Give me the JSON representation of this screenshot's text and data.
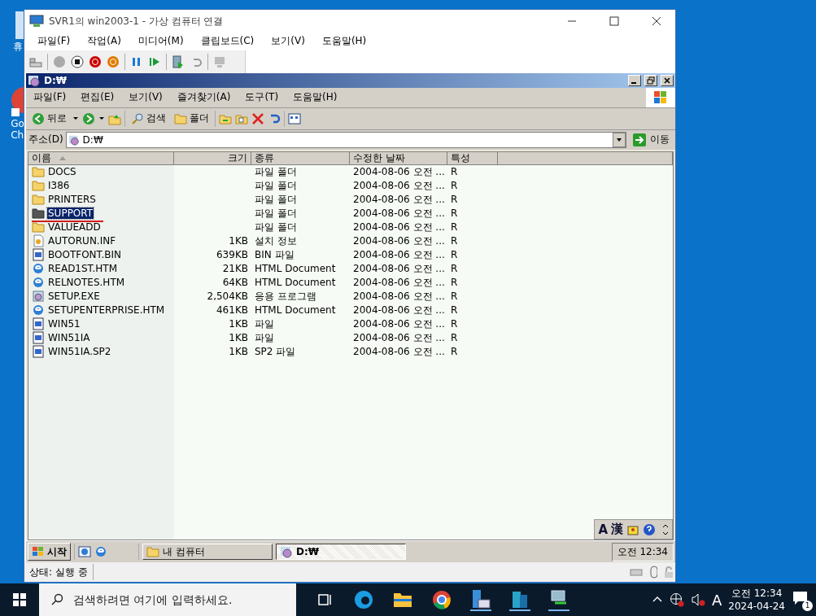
{
  "desktop_icons": [
    {
      "lines": [
        "휴"
      ]
    },
    {
      "lines": [
        "Go",
        "Ch"
      ]
    }
  ],
  "vm_window": {
    "title": "SVR1의 win2003-1 - 가상 컴퓨터 연결",
    "menu": [
      "파일(F)",
      "작업(A)",
      "미디어(M)",
      "클립보드(C)",
      "보기(V)",
      "도움말(H)"
    ],
    "status": "상태: 실행 중"
  },
  "explorer": {
    "title": "D:₩",
    "menu": [
      "파일(F)",
      "편집(E)",
      "보기(V)",
      "즐겨찾기(A)",
      "도구(T)",
      "도움말(H)"
    ],
    "toolbar": {
      "back": "뒤로",
      "search": "검색",
      "folders": "폴더"
    },
    "address": {
      "label": "주소(D)",
      "value": "D:₩",
      "go": "이동"
    },
    "columns": [
      {
        "label": "이름",
        "sorted": true
      },
      {
        "label": "크기",
        "sorted": false
      },
      {
        "label": "종류",
        "sorted": false
      },
      {
        "label": "수정한 날짜",
        "sorted": false
      },
      {
        "label": "특성",
        "sorted": false
      }
    ],
    "files": [
      {
        "name": "DOCS",
        "type": "파일 폴더",
        "date": "2004-08-06 오전 ...",
        "attr": "R",
        "kind": "folder",
        "selected": false
      },
      {
        "name": "I386",
        "type": "파일 폴더",
        "date": "2004-08-06 오전 ...",
        "attr": "R",
        "kind": "folder",
        "selected": false
      },
      {
        "name": "PRINTERS",
        "type": "파일 폴더",
        "date": "2004-08-06 오전 ...",
        "attr": "R",
        "kind": "folder",
        "selected": false
      },
      {
        "name": "SUPPORT",
        "type": "파일 폴더",
        "date": "2004-08-06 오전 ...",
        "attr": "R",
        "kind": "folder",
        "selected": true
      },
      {
        "name": "VALUEADD",
        "type": "파일 폴더",
        "date": "2004-08-06 오전 ...",
        "attr": "R",
        "kind": "folder",
        "selected": false
      },
      {
        "name": "AUTORUN.INF",
        "size": "1KB",
        "type": "설치 정보",
        "date": "2004-08-06 오전 ...",
        "attr": "R",
        "kind": "setup-info",
        "selected": false
      },
      {
        "name": "BOOTFONT.BIN",
        "size": "639KB",
        "type": "BIN 파일",
        "date": "2004-08-06 오전 ...",
        "attr": "R",
        "kind": "file",
        "selected": false
      },
      {
        "name": "READ1ST.HTM",
        "size": "21KB",
        "type": "HTML Document",
        "date": "2004-08-06 오전 ...",
        "attr": "R",
        "kind": "html",
        "selected": false
      },
      {
        "name": "RELNOTES.HTM",
        "size": "64KB",
        "type": "HTML Document",
        "date": "2004-08-06 오전 ...",
        "attr": "R",
        "kind": "html",
        "selected": false
      },
      {
        "name": "SETUP.EXE",
        "size": "2,504KB",
        "type": "응용 프로그램",
        "date": "2004-08-06 오전 ...",
        "attr": "R",
        "kind": "exe",
        "selected": false
      },
      {
        "name": "SETUPENTERPRISE.HTM",
        "size": "461KB",
        "type": "HTML Document",
        "date": "2004-08-06 오전 ...",
        "attr": "R",
        "kind": "html",
        "selected": false
      },
      {
        "name": "WIN51",
        "size": "1KB",
        "type": "파일",
        "date": "2004-08-06 오전 ...",
        "attr": "R",
        "kind": "file",
        "selected": false
      },
      {
        "name": "WIN51IA",
        "size": "1KB",
        "type": "파일",
        "date": "2004-08-06 오전 ...",
        "attr": "R",
        "kind": "file",
        "selected": false
      },
      {
        "name": "WIN51IA.SP2",
        "size": "1KB",
        "type": "SP2 파일",
        "date": "2004-08-06 오전 ...",
        "attr": "R",
        "kind": "file",
        "selected": false
      }
    ],
    "lang_bar": [
      "A",
      "漢"
    ]
  },
  "guest_taskbar": {
    "start": "시작",
    "tasks": [
      {
        "label": "내 컴퓨터",
        "kind": "folder",
        "selected": false
      },
      {
        "label": "D:₩",
        "kind": "drive",
        "selected": true
      }
    ],
    "clock": "오전 12:34"
  },
  "host_taskbar": {
    "search_placeholder": "검색하려면 여기에 입력하세요.",
    "ime": "A",
    "time": "오전 12:34",
    "date": "2024-04-24",
    "notification_count": "1"
  }
}
